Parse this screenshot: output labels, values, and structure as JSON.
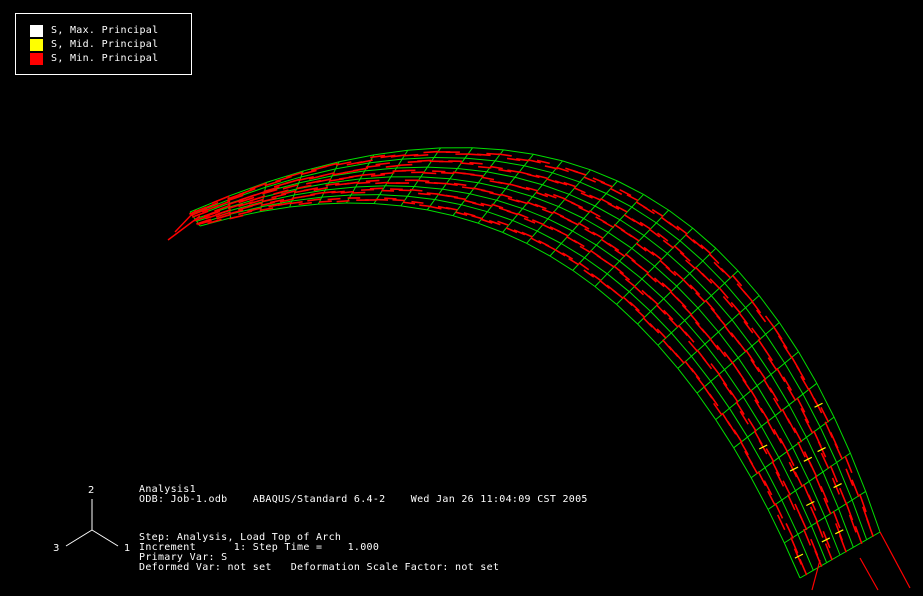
{
  "legend": {
    "items": [
      {
        "label": "S, Max. Principal",
        "color": "#ffffff"
      },
      {
        "label": "S, Mid. Principal",
        "color": "#ffff00"
      },
      {
        "label": "S, Min. Principal",
        "color": "#ff0000"
      }
    ]
  },
  "colors": {
    "background": "#000000",
    "mesh": "#00dd00",
    "min_principal": "#ff0000",
    "mid_principal": "#ffff00",
    "max_principal": "#ffffff",
    "text": "#ffffff"
  },
  "info_block": {
    "model_name": "Analysis1",
    "odb_line": "ODB: Job-1.odb    ABAQUS/Standard 6.4-2    Wed Jan 26 11:04:09 CST 2005",
    "step_line": "Step: Analysis, Load Top of Arch",
    "increment_line": "Increment      1: Step Time =    1.000",
    "primary_var_line": "Primary Var: S",
    "deformed_var_line": "Deformed Var: not set   Deformation Scale Factor: not set"
  },
  "triad": {
    "axis_up": "2",
    "axis_left": "3",
    "axis_right": "1"
  }
}
